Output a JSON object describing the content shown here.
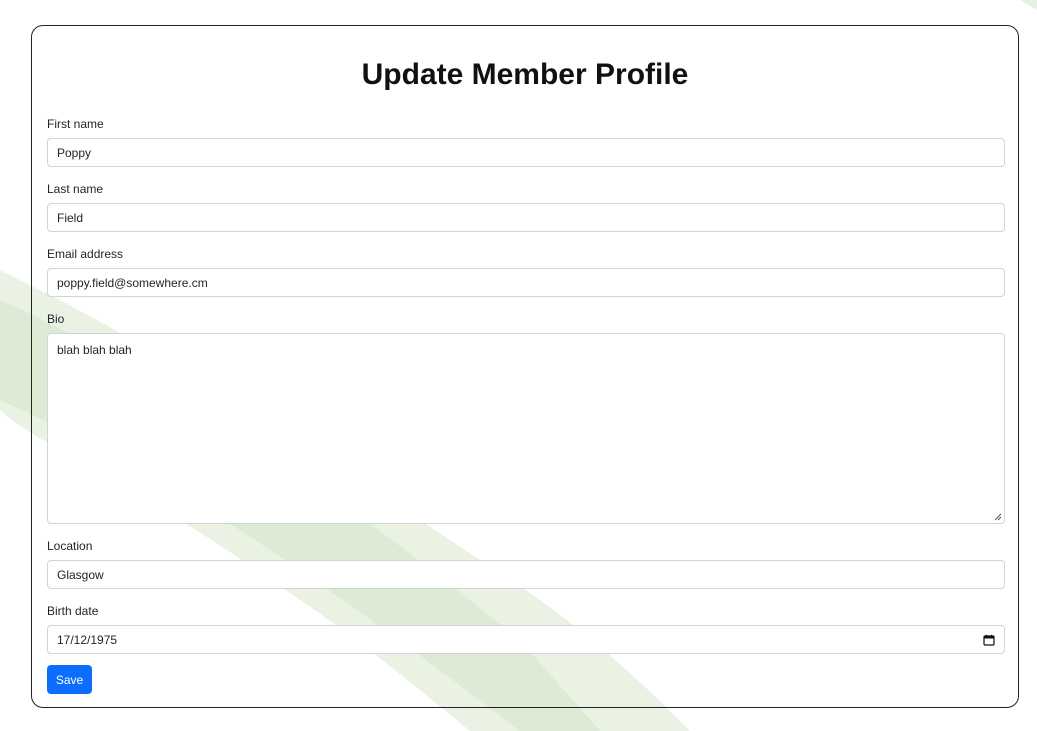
{
  "page": {
    "title": "Update Member Profile"
  },
  "form": {
    "first_name": {
      "label": "First name",
      "value": "Poppy"
    },
    "last_name": {
      "label": "Last name",
      "value": "Field"
    },
    "email": {
      "label": "Email address",
      "value": "poppy.field@somewhere.cm"
    },
    "bio": {
      "label": "Bio",
      "value": "blah blah blah"
    },
    "location": {
      "label": "Location",
      "value": "Glasgow"
    },
    "birth_date": {
      "label": "Birth date",
      "value": "17/12/1975",
      "icon": "calendar-icon"
    },
    "save_label": "Save"
  },
  "colors": {
    "primary": "#0d6efd",
    "field_border": "#ced4da",
    "card_border": "#222222",
    "splash": "#d8e8cc"
  }
}
